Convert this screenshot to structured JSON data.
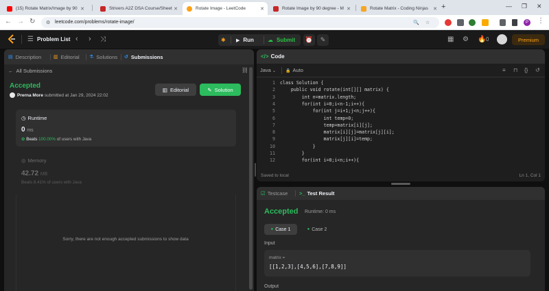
{
  "browser": {
    "tabs": [
      {
        "title": "(15) Rotate Matrix/Image by 90",
        "color": "#ff0000",
        "active": false
      },
      {
        "title": "Strivers A2Z DSA Course/Sheet",
        "color": "#c62828",
        "active": false
      },
      {
        "title": "Rotate Image - LeetCode",
        "color": "#ffa116",
        "active": true
      },
      {
        "title": "Rotate Image by 90 degree - M",
        "color": "#c62828",
        "active": false
      },
      {
        "title": "Rotate Matrix - Coding Ninjas",
        "color": "#f5a623",
        "active": false
      }
    ],
    "url": "leetcode.com/problems/rotate-image/",
    "profile_initial": "P"
  },
  "nav": {
    "problem_list": "Problem List",
    "run": "Run",
    "submit": "Submit",
    "streak": "0",
    "premium": "Premium"
  },
  "left": {
    "tabs": [
      "Description",
      "Editorial",
      "Solutions",
      "Submissions"
    ],
    "all_submissions": "All Submissions",
    "status": "Accepted",
    "user": "Prerna More",
    "submitted_text": "submitted at Jan 29, 2024 22:02",
    "editorial_btn": "Editorial",
    "solution_btn": "Solution",
    "runtime": {
      "label": "Runtime",
      "value": "0",
      "unit": "ms",
      "beats_label": "Beats",
      "beats_pct": "100.00%",
      "beats_suffix": "of users with Java"
    },
    "memory": {
      "label": "Memory",
      "value": "42.72",
      "unit": "MB",
      "beats_text": "Beats 8.41% of users with Java"
    },
    "empty_msg": "Sorry, there are not enough accepted submissions to show data"
  },
  "code": {
    "title": "Code",
    "language": "Java",
    "mode": "Auto",
    "lines": [
      {
        "n": "1",
        "text": "class Solution {"
      },
      {
        "n": "2",
        "text": "    public void rotate(int[][] matrix) {"
      },
      {
        "n": "3",
        "text": "        int n=matrix.length;"
      },
      {
        "n": "4",
        "text": "        for(int i=0;i<n-1;i++){"
      },
      {
        "n": "5",
        "text": "            for(int j=i+1;j<n;j++){"
      },
      {
        "n": "6",
        "text": "                int temp=0;"
      },
      {
        "n": "7",
        "text": "                temp=matrix[i][j];"
      },
      {
        "n": "8",
        "text": "                matrix[i][j]=matrix[j][i];"
      },
      {
        "n": "9",
        "text": "                matrix[j][i]=temp;"
      },
      {
        "n": "10",
        "text": "            }"
      },
      {
        "n": "11",
        "text": "        }"
      },
      {
        "n": "12",
        "text": "        for(int i=0;i<n;i++){"
      }
    ],
    "saved": "Saved to local",
    "cursor": "Ln 1, Col 1"
  },
  "test": {
    "tab_testcase": "Testcase",
    "tab_result": "Test Result",
    "status": "Accepted",
    "runtime": "Runtime: 0 ms",
    "case1": "Case 1",
    "case2": "Case 2",
    "input_label": "Input",
    "param": "matrix =",
    "value": "[[1,2,3],[4,5,6],[7,8,9]]",
    "output_label": "Output"
  },
  "colors": {
    "accent": "#ffa116",
    "green": "#2cbb5d",
    "submit": "#28c244"
  }
}
